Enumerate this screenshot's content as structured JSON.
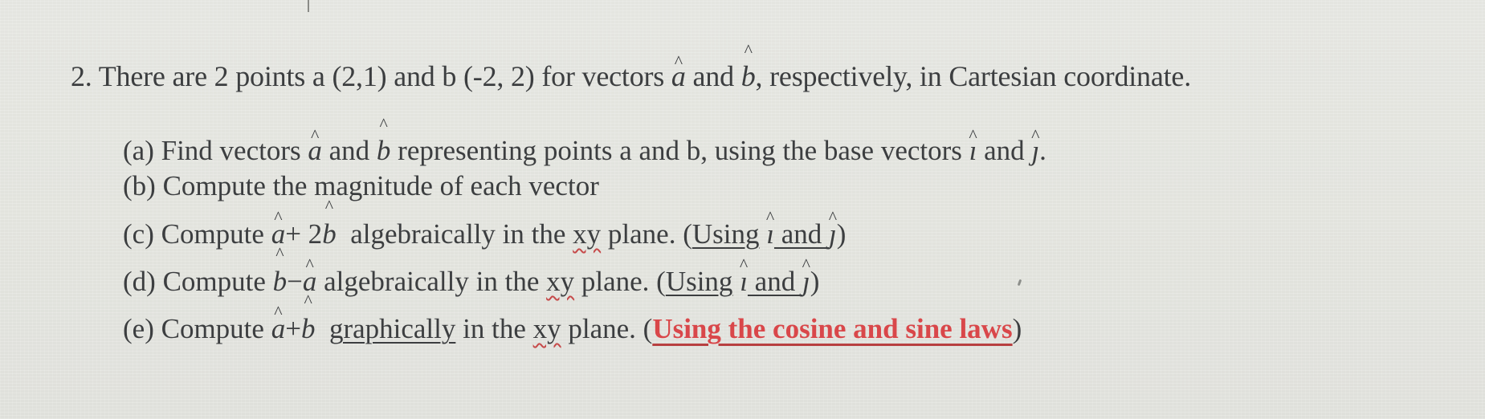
{
  "document": {
    "question": {
      "number": "2.",
      "text_1": "There are 2 points a (2,1) and b (-2, 2) for vectors",
      "vec_a": "a",
      "and_1": "and",
      "vec_b": "b",
      "text_2": ", respectively, in Cartesian coordinate."
    },
    "parts": [
      {
        "label": "(a)",
        "pre": "Find vectors",
        "vec_a": "a",
        "and": "and",
        "vec_b": "b",
        "mid": "representing points a and b, using the base vectors",
        "vec_i": "ı",
        "and_2": "and",
        "vec_j": "ȷ",
        "end": "."
      },
      {
        "label": "(b)",
        "text": "Compute the magnitude of each vector"
      },
      {
        "label": "(c)",
        "pre": "Compute",
        "expr_v1": "a",
        "expr_op": "+ 2",
        "expr_v2": "b",
        "method": "algebraically",
        "mid": "in the",
        "xy": "xy",
        "plane": "plane. (",
        "using": "Using",
        "vec_i": "ı",
        "and": " and ",
        "vec_j": "ȷ",
        "close": ")"
      },
      {
        "label": "(d)",
        "pre": "Compute",
        "expr_v1": "b",
        "expr_op": "−",
        "expr_v2": "a",
        "method": "algebraically",
        "mid": "in the",
        "xy": "xy",
        "plane": "plane. (",
        "using": "Using",
        "vec_i": "ı",
        "and": " and ",
        "vec_j": "ȷ",
        "close": ")"
      },
      {
        "label": "(e)",
        "pre": "Compute",
        "expr_v1": "a",
        "expr_op": "+",
        "expr_v2": "b",
        "method": "graphically",
        "mid": "in the",
        "xy": "xy",
        "plane": "plane. (",
        "note": "Using the cosine and sine laws",
        "close": ")"
      }
    ],
    "hat_glyph": "^",
    "colors": {
      "text": "#3c3e40",
      "highlight_red": "#d9474a",
      "spellcheck_red": "#c64a4a",
      "background": "#e3e4df"
    }
  }
}
